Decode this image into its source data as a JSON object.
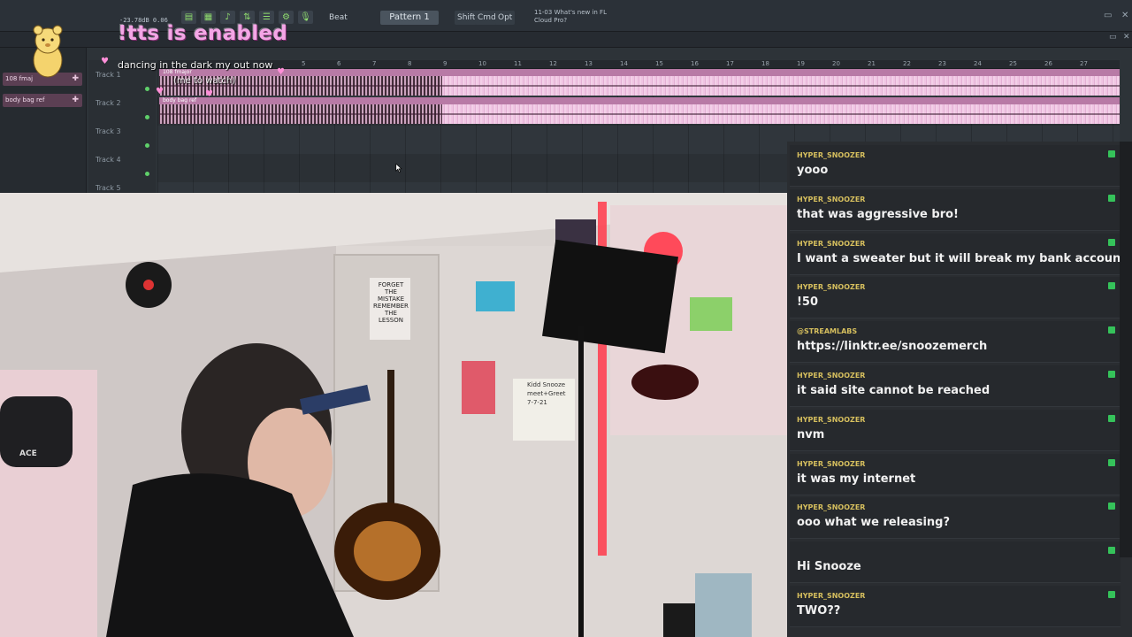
{
  "daw": {
    "cpu_readout": "-23.78dB  0.06",
    "pattern_label": "Pattern 1",
    "beat_label": "Beat",
    "keys": [
      "Shift",
      "Cmd",
      "Opt"
    ],
    "news_line1": "11-03  What's new in FL",
    "news_line2": "Cloud Pro?",
    "tracks": [
      "Track 1",
      "Track 2",
      "Track 3",
      "Track 4",
      "Track 5"
    ],
    "left_tracks": [
      "108 fmaj",
      "body bag ref"
    ],
    "clip_labels": [
      "108 fmajor",
      "body bag ref"
    ],
    "ruler_marks": [
      "5",
      "6",
      "7",
      "8",
      "9",
      "10",
      "11",
      "12",
      "13",
      "14",
      "15",
      "16",
      "17",
      "18",
      "19",
      "20",
      "21",
      "22",
      "23",
      "24",
      "25",
      "26",
      "27"
    ]
  },
  "overlay": {
    "title": "!tts is enabled",
    "now_playing": "dancing in the dark my out now",
    "now_sub": "(me to watch)"
  },
  "chat": {
    "messages": [
      {
        "user": "HYPER_SNOOZER",
        "text": "yooo",
        "color": "#d6bf5e"
      },
      {
        "user": "HYPER_SNOOZER",
        "text": "that was aggressive bro!",
        "color": "#d6bf5e"
      },
      {
        "user": "HYPER_SNOOZER",
        "text": "I want a sweater but it will break my bank account",
        "color": "#d6bf5e"
      },
      {
        "user": "HYPER_SNOOZER",
        "text": "!50",
        "color": "#d6bf5e"
      },
      {
        "user": "@STREAMLABS",
        "text": "https://linktr.ee/snoozemerch",
        "color": "#d6bf5e"
      },
      {
        "user": "HYPER_SNOOZER",
        "text": "it said site cannot be reached",
        "color": "#d6bf5e"
      },
      {
        "user": "HYPER_SNOOZER",
        "text": "nvm",
        "color": "#d6bf5e"
      },
      {
        "user": "HYPER_SNOOZER",
        "text": "it was my internet",
        "color": "#d6bf5e"
      },
      {
        "user": "HYPER_SNOOZER",
        "text": "ooo what we releasing?",
        "color": "#d6bf5e"
      },
      {
        "user": "",
        "text": "Hi Snooze",
        "color": "#d23a3a"
      },
      {
        "user": "HYPER_SNOOZER",
        "text": "TWO??",
        "color": "#d6bf5e"
      }
    ]
  },
  "camera": {
    "poster_text": [
      "FORGET",
      "THE",
      "MISTAKE",
      "REMEMBER",
      "THE",
      "LESSON"
    ],
    "chair_badge": "ACE",
    "wall_note": [
      "Kidd Snooze",
      "meet+Greet",
      "7-7-21"
    ]
  },
  "colors": {
    "accent": "#f4a6e6",
    "clip": "#d49ac3",
    "chat_bg": "#2a2d31",
    "username": "#d6bf5e",
    "badge": "#35c25a"
  }
}
